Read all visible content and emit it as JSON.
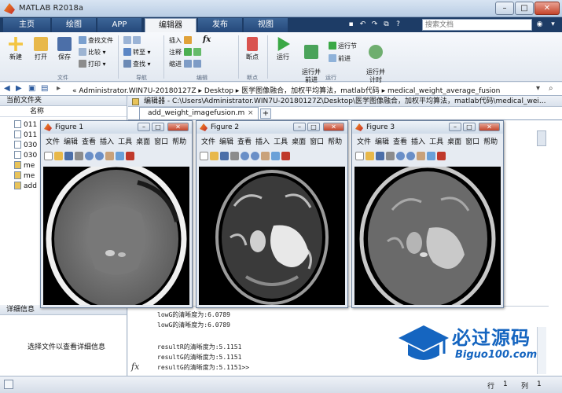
{
  "window": {
    "title": "MATLAB R2018a",
    "min": "–",
    "max": "□",
    "close": "✕"
  },
  "tabs": [
    {
      "label": "主页"
    },
    {
      "label": "绘图"
    },
    {
      "label": "APP"
    },
    {
      "label": "编辑器",
      "active": true
    },
    {
      "label": "发布"
    },
    {
      "label": "视图"
    }
  ],
  "search": {
    "placeholder": "搜索文档"
  },
  "ribbon": {
    "file": {
      "new": "新建",
      "open": "打开",
      "save": "保存",
      "find_files": "查找文件",
      "compare": "比较",
      "print": "打印",
      "group": "文件"
    },
    "navigate": {
      "goto": "转至",
      "find": "查找",
      "group": "导航"
    },
    "edit": {
      "insert": "插入",
      "comment": "注释",
      "indent": "缩进",
      "fx": "fx",
      "group": "编辑"
    },
    "breakpoints": {
      "label": "断点",
      "group": "断点"
    },
    "run": {
      "run": "运行",
      "run_advance": "运行并\n前进",
      "run_section": "运行节",
      "advance": "前进",
      "run_time": "运行并\n计时",
      "group": "运行"
    }
  },
  "address": {
    "path": "« Administrator.WIN7U-20180127Z ▸ Desktop ▸ 医学图像融合，加权平均算法，matlab代码 ▸ medical_weight_average_fusion"
  },
  "current_folder": {
    "title": "当前文件夹",
    "column": "名称",
    "files": [
      "011",
      "011",
      "030",
      "030",
      "me",
      "me",
      "add"
    ]
  },
  "details": {
    "title": "详细信息",
    "hint": "选择文件以查看详细信息"
  },
  "editor": {
    "header": "编辑器 - C:\\Users\\Administrator.WIN7U-20180127Z\\Desktop\\医学图像融合，加权平均算法，matlab代码\\medical_wei...",
    "tab": "add_weight_imagefusion.m",
    "plus": "+"
  },
  "command": {
    "lines": [
      "lowG的清晰度为:6.0789",
      "lowG的清晰度为:6.0789",
      "",
      "resultR的清晰度为:5.1151",
      "resultG的清晰度为:5.1151",
      "resultG的清晰度为:5.1151>>"
    ],
    "fx": "fx"
  },
  "figures": [
    {
      "title": "Figure 1",
      "image": "ct-scan"
    },
    {
      "title": "Figure 2",
      "image": "mri-scan"
    },
    {
      "title": "Figure 3",
      "image": "fused-scan"
    }
  ],
  "figure_menu": [
    "文件",
    "编辑",
    "查看",
    "插入",
    "工具",
    "桌面",
    "窗口",
    "帮助"
  ],
  "status": {
    "row_label": "行",
    "row": "1",
    "col_label": "列",
    "col": "1"
  },
  "watermark": {
    "text": "必过源码",
    "url": "Biguo100.com"
  }
}
